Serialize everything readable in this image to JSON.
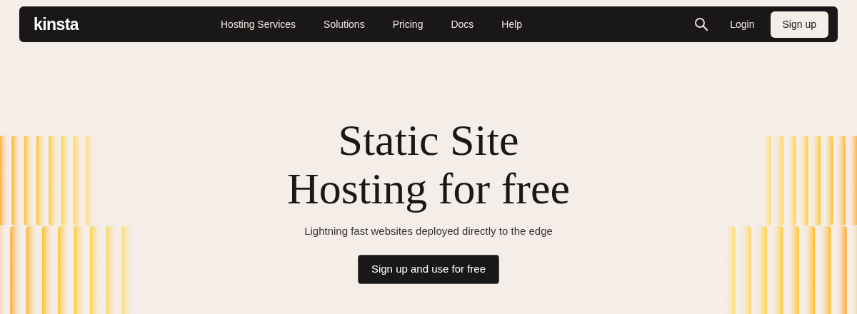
{
  "nav": {
    "logo": "kinsta",
    "links": [
      {
        "label": "Hosting Services"
      },
      {
        "label": "Solutions"
      },
      {
        "label": "Pricing"
      },
      {
        "label": "Docs"
      },
      {
        "label": "Help"
      }
    ],
    "login": "Login",
    "signup": "Sign up"
  },
  "hero": {
    "title_lines": [
      "Static Site",
      "Hosting for free"
    ],
    "subtitle": "Lightning fast websites deployed directly to the edge",
    "cta": "Sign up and use for free"
  }
}
